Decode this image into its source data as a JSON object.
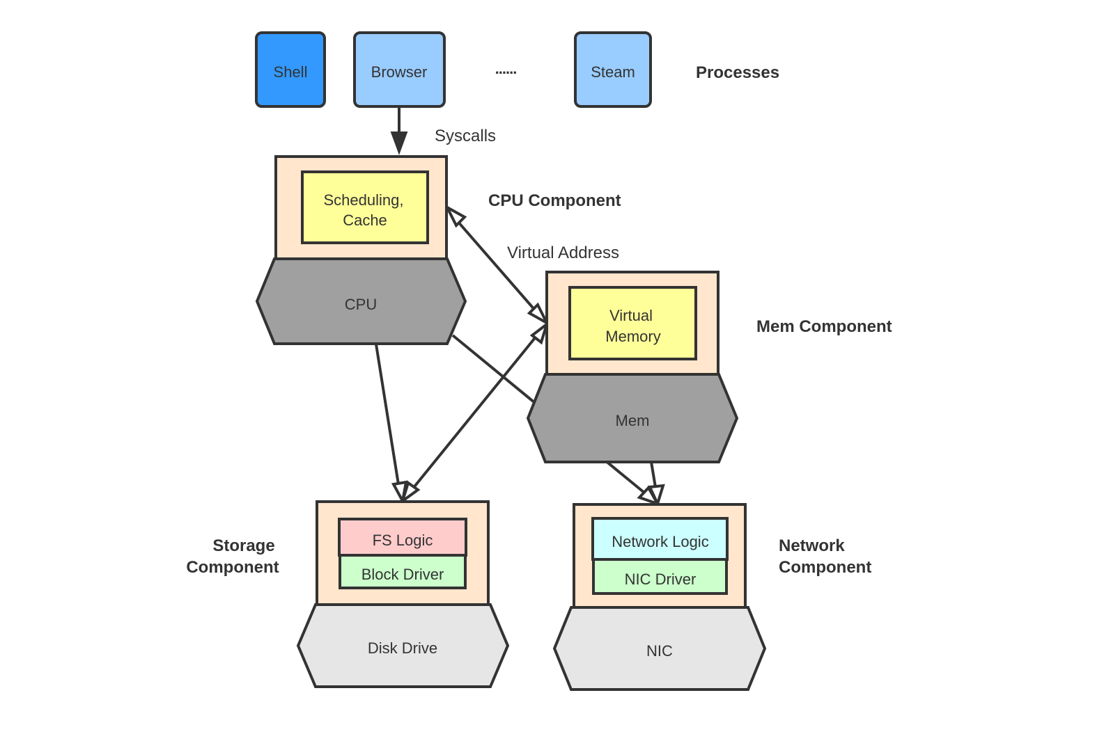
{
  "diagram": {
    "processes": {
      "label": "Processes",
      "items": [
        {
          "id": "shell",
          "label": "Shell",
          "fill": "#3399ff"
        },
        {
          "id": "browser",
          "label": "Browser",
          "fill": "#99ccff"
        },
        {
          "id": "ellipsis",
          "label": "......"
        },
        {
          "id": "steam",
          "label": "Steam",
          "fill": "#99ccff"
        }
      ]
    },
    "edge_labels": {
      "syscalls": "Syscalls",
      "virtual_address": "Virtual Address"
    },
    "components": {
      "cpu": {
        "label": "CPU Component",
        "inner": [
          "Scheduling,",
          "Cache"
        ],
        "hardware": "CPU"
      },
      "mem": {
        "label": "Mem Component",
        "inner": [
          "Virtual",
          "Memory"
        ],
        "hardware": "Mem"
      },
      "storage": {
        "label": [
          "Storage",
          "Component"
        ],
        "logic": "FS Logic",
        "driver": "Block Driver",
        "hardware": "Disk Drive"
      },
      "network": {
        "label": [
          "Network",
          "Component"
        ],
        "logic": "Network Logic",
        "driver": "NIC Driver",
        "hardware": "NIC"
      }
    },
    "edges": [
      {
        "from": "browser",
        "to": "cpu",
        "label": "Syscalls",
        "arrow": "filled"
      },
      {
        "from": "cpu",
        "to": "mem",
        "label": "Virtual Address",
        "arrow": "open-both"
      },
      {
        "from": "cpu",
        "to": "storage",
        "arrow": "open"
      },
      {
        "from": "storage",
        "to": "mem",
        "arrow": "open-both"
      },
      {
        "from": "cpu",
        "to": "network",
        "arrow": "open"
      },
      {
        "from": "mem",
        "to": "network",
        "arrow": "open"
      }
    ],
    "colors": {
      "component_bg": "#ffe6cc",
      "logic_yellow": "#ffff99",
      "fs_logic": "#ffcccc",
      "driver_green": "#ccffcc",
      "network_logic": "#ccffff",
      "hw_dark": "#a0a0a0",
      "hw_light": "#e6e6e6",
      "stroke": "#333333"
    }
  }
}
